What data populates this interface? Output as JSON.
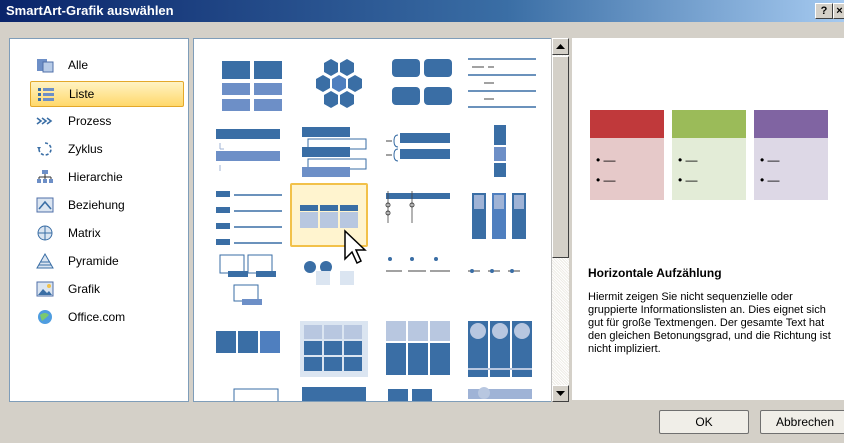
{
  "dialog": {
    "title": "SmartArt-Grafik auswählen",
    "help_label": "?",
    "close_label": "×"
  },
  "categories": [
    {
      "label": "Alle",
      "icon": "all-icon"
    },
    {
      "label": "Liste",
      "icon": "list-icon",
      "selected": true
    },
    {
      "label": "Prozess",
      "icon": "process-icon"
    },
    {
      "label": "Zyklus",
      "icon": "cycle-icon"
    },
    {
      "label": "Hierarchie",
      "icon": "hierarchy-icon"
    },
    {
      "label": "Beziehung",
      "icon": "relationship-icon"
    },
    {
      "label": "Matrix",
      "icon": "matrix-icon"
    },
    {
      "label": "Pyramide",
      "icon": "pyramid-icon"
    },
    {
      "label": "Grafik",
      "icon": "picture-icon"
    },
    {
      "label": "Office.com",
      "icon": "office-com-icon"
    }
  ],
  "preview": {
    "title": "Horizontale Aufzählung",
    "description": "Hiermit zeigen Sie nicht sequenzielle oder gruppierte Informationslisten an. Dies eignet sich gut für große Textmengen. Der gesamte Text hat den gleichen Betonungsgrad, und die Richtung ist nicht impliziert.",
    "colors": [
      "#c0393b",
      "#9bbb59",
      "#8064a2"
    ],
    "bullet_text": "• —"
  },
  "buttons": {
    "ok": "OK",
    "cancel": "Abbrechen"
  }
}
